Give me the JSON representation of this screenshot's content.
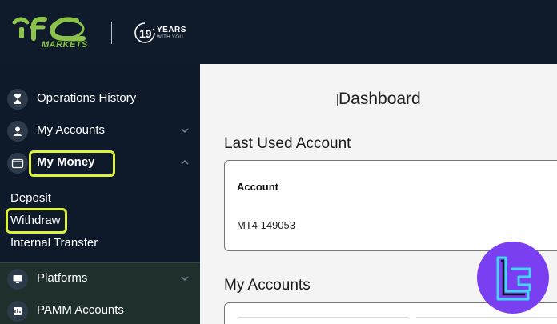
{
  "header": {
    "brand_sub": "MARKETS",
    "years_number": "19",
    "years_label": "YEARS",
    "years_sub": "WITH YOU"
  },
  "sidebar": {
    "items": [
      {
        "label": "Operations History",
        "icon": "hourglass-icon"
      },
      {
        "label": "My Accounts",
        "icon": "user-icon"
      },
      {
        "label": "My Money",
        "icon": "wallet-icon",
        "expanded": true
      },
      {
        "label": "Platforms",
        "icon": "monitor-icon"
      },
      {
        "label": "PAMM Accounts",
        "icon": "pamm-icon"
      }
    ],
    "money_subitems": [
      "Deposit",
      "Withdraw",
      "Internal Transfer"
    ]
  },
  "main": {
    "title": "Dashboard",
    "last_used_title": "Last Used Account",
    "account_label": "Account",
    "account_value": "MT4 149053",
    "my_accounts_title": "My Accounts"
  },
  "colors": {
    "sidebar_bg": "#0e1a2a",
    "highlight": "#dcf238",
    "brand_green": "#8bc34a",
    "badge_purple": "#7b3ff2",
    "badge_cyan": "#3fd6ff"
  }
}
